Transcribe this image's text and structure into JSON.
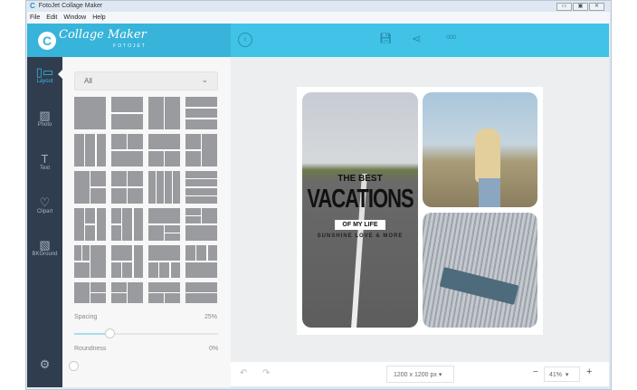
{
  "window": {
    "title": "FotoJet Collage Maker",
    "controls": [
      "minimize",
      "restore",
      "close"
    ]
  },
  "menu": [
    "File",
    "Edit",
    "Window",
    "Help"
  ],
  "header": {
    "logo_text": "Collage Maker",
    "logo_sub": "FOTOJET",
    "icons": [
      "back-circle-icon",
      "save-icon",
      "share-icon",
      "more-icon"
    ]
  },
  "sidebar": {
    "items": [
      {
        "label": "Layout",
        "icon": "layout-icon",
        "active": true
      },
      {
        "label": "Photo",
        "icon": "photo-icon"
      },
      {
        "label": "Text",
        "icon": "text-icon"
      },
      {
        "label": "Clipart",
        "icon": "heart-icon"
      },
      {
        "label": "BKGround",
        "icon": "background-icon"
      }
    ],
    "settings_icon": "gear-icon"
  },
  "panel": {
    "filter": "All",
    "spacing_label": "Spacing",
    "spacing_value": "25%",
    "spacing": 25,
    "roundness_label": "Roundness",
    "roundness_value": "0%",
    "roundness": 0
  },
  "canvas": {
    "overlay": {
      "line1": "THE BEST",
      "line2": "VACATIONS",
      "line3": "OF MY LIFE",
      "line4": "SUNSHINE LOVE & MORE"
    }
  },
  "bottom": {
    "size": "1200 x 1200 px",
    "zoom": "41%",
    "zoom_out": "−",
    "zoom_in": "+"
  },
  "colors": {
    "header": "#40c3e6",
    "sidebar": "#2f3d4f",
    "accent": "#38b8e0"
  }
}
